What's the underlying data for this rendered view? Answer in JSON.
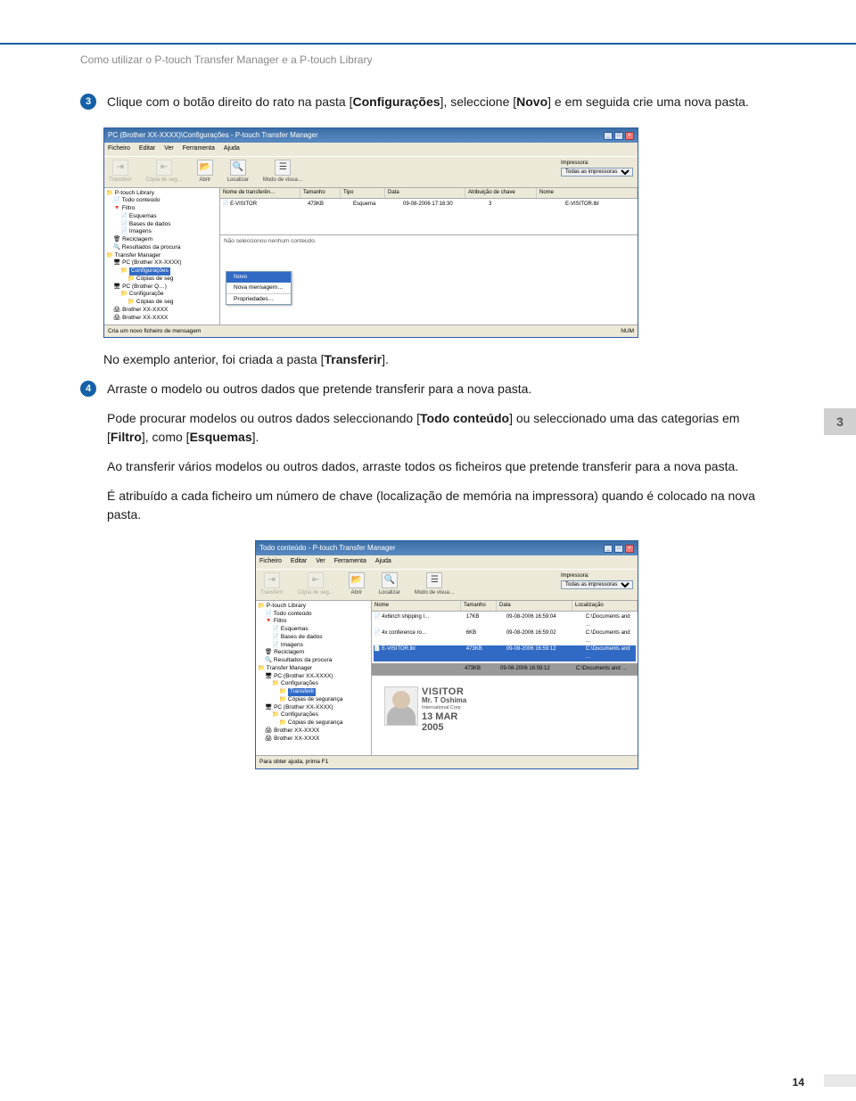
{
  "breadcrumb": "Como utilizar o P-touch Transfer Manager e a P-touch Library",
  "steps": {
    "s3": {
      "num": "3",
      "p1a": "Clique com o botão direito do rato na pasta [",
      "p1b": "Configurações",
      "p1c": "], seleccione [",
      "p1d": "Novo",
      "p1e": "] e em seguida crie uma nova pasta."
    },
    "note": {
      "a": "No exemplo anterior, foi criada a pasta [",
      "b": "Transferir",
      "c": "]."
    },
    "s4": {
      "num": "4",
      "p1": "Arraste o modelo ou outros dados que pretende transferir para a nova pasta.",
      "p2a": "Pode procurar modelos ou outros dados seleccionando [",
      "p2b": "Todo conteúdo",
      "p2c": "] ou seleccionado uma das categorias em [",
      "p2d": "Filtro",
      "p2e": "], como [",
      "p2f": "Esquemas",
      "p2g": "].",
      "p3": "Ao transferir vários modelos ou outros dados, arraste todos os ficheiros que pretende transferir para a nova pasta.",
      "p4": "É atribuído a cada ficheiro um número de chave (localização de memória na impressora) quando é colocado na nova pasta."
    }
  },
  "side_tab": "3",
  "page_number": "14",
  "shot1": {
    "title": "PC (Brother XX-XXXX)\\Configurações - P-touch Transfer Manager",
    "menus": [
      "Ficheiro",
      "Editar",
      "Ver",
      "Ferramenta",
      "Ajuda"
    ],
    "toolbar": {
      "back": "Transferir",
      "backup": "Cópia de seg…",
      "open": "Abrir",
      "search": "Localizar",
      "view": "Modo de visua…"
    },
    "printer_label": "Impressora:",
    "printer_value": "Todas as impressoras",
    "tree": [
      "P-touch Library",
      " Todo conteúdo",
      " Filtro",
      "  Esquemas",
      "  Bases de dados",
      "  Imagens",
      " Reciclagem",
      " Resultados da procura",
      "Transfer Manager",
      " PC (Brother XX-XXXX)",
      "  Configurações",
      "   Cópias de seg",
      " PC (Brother Q…)",
      "  Configuraçõe",
      "   Cópias de seg",
      " Brother XX-XXXX",
      " Brother XX-XXXX"
    ],
    "sel_node": "Configurações",
    "ctx": {
      "novo": "Novo",
      "nova_msg": "Nova mensagem…",
      "props": "Propriedades…"
    },
    "cols": [
      "Nome de transferên…",
      "Tamanho",
      "Tipo",
      "Data",
      "Atribuição de chave",
      "Nome"
    ],
    "row": [
      "E-VISITOR",
      "473KB",
      "Esquema",
      "09-08-2006 17:16:30",
      "3",
      "E-VISITOR.lbl"
    ],
    "empty_preview": "Não seleccionou nenhum conteúdo.",
    "status_left": "Cria um novo ficheiro de mensagem",
    "status_right": "NUM"
  },
  "shot2": {
    "title": "Todo conteúdo - P-touch Transfer Manager",
    "menus": [
      "Ficheiro",
      "Editar",
      "Ver",
      "Ferramenta",
      "Ajuda"
    ],
    "toolbar": {
      "back": "Transferir",
      "backup": "Cópia de seg…",
      "open": "Abrir",
      "search": "Localizar",
      "view": "Modo de visua…"
    },
    "printer_label": "Impressora:",
    "printer_value": "Todas as impressoras",
    "tree": [
      "P-touch Library",
      " Todo conteúdo",
      " Filtro",
      "  Esquemas",
      "  Bases de dados",
      "  Imagens",
      " Reciclagem",
      " Resultados da procura",
      "Transfer Manager",
      " PC (Brother XX-XXXX)",
      "  Configurações",
      "   Transferir",
      "   Cópias de segurança",
      " PC (Brother XX-XXXX)",
      "  Configurações",
      "   Cópias de segurança",
      " Brother XX-XXXX",
      " Brother XX-XXXX"
    ],
    "sel_node": "Transferir",
    "cols": [
      "Nome",
      "Tamanho",
      "Data",
      "Localização"
    ],
    "rows": [
      [
        "4x6inch shipping l…",
        "17KB",
        "09-08-2006 16:59:04",
        "C:\\Documents and …"
      ],
      [
        "4x conference ro…",
        "6KB",
        "09-08-2006 16:59:02",
        "C:\\Documents and …"
      ],
      [
        "E-VISITOR.lbl",
        "473KB",
        "09-08-2006 16:59:12",
        "C:\\Documents and …"
      ]
    ],
    "sel_row_vals": [
      "",
      "473KB",
      "09-08-2006 16:59:12",
      "C:\\Documents and …"
    ],
    "visitor": {
      "title": "VISITOR",
      "name": "Mr. T Oshima",
      "corp": "International Corp",
      "date_top": "13 MAR",
      "date_bot": "2005"
    },
    "status_left": "Para obter ajuda, prima F1",
    "status_right": ""
  }
}
